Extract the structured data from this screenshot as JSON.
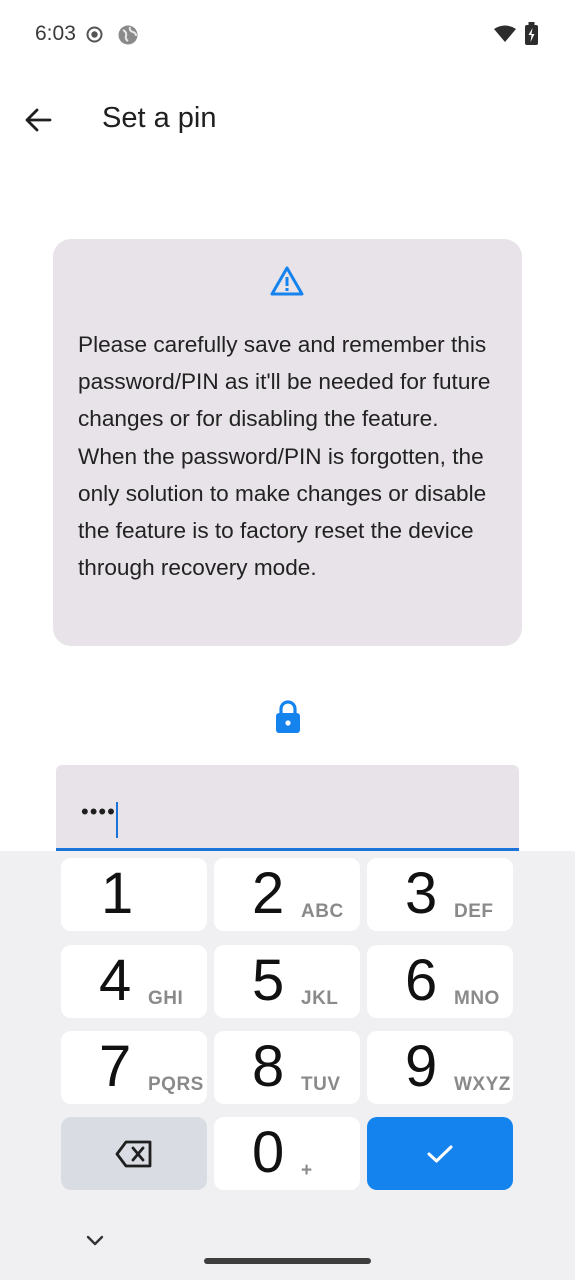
{
  "status_bar": {
    "time": "6:03"
  },
  "app_bar": {
    "title": "Set a pin"
  },
  "warning": {
    "text": "Please carefully save and remember this password/PIN as it'll be needed for future changes or for disabling the feature.\nWhen the password/PIN is forgotten, the only solution to make changes or disable the feature is to factory reset the device through recovery mode."
  },
  "pin_input": {
    "value": "••••"
  },
  "keypad": {
    "keys": [
      {
        "digit": "1",
        "letters": ""
      },
      {
        "digit": "2",
        "letters": "ABC"
      },
      {
        "digit": "3",
        "letters": "DEF"
      },
      {
        "digit": "4",
        "letters": "GHI"
      },
      {
        "digit": "5",
        "letters": "JKL"
      },
      {
        "digit": "6",
        "letters": "MNO"
      },
      {
        "digit": "7",
        "letters": "PQRS"
      },
      {
        "digit": "8",
        "letters": "TUV"
      },
      {
        "digit": "9",
        "letters": "WXYZ"
      },
      {
        "digit": "0",
        "letters": "+"
      }
    ]
  },
  "colors": {
    "accent": "#1583ee",
    "card": "#e7e3e8"
  },
  "icons": [
    "back-arrow-icon",
    "warning-icon",
    "lock-icon",
    "backspace-icon",
    "check-icon",
    "chevron-down-icon",
    "wifi-icon",
    "battery-icon"
  ]
}
